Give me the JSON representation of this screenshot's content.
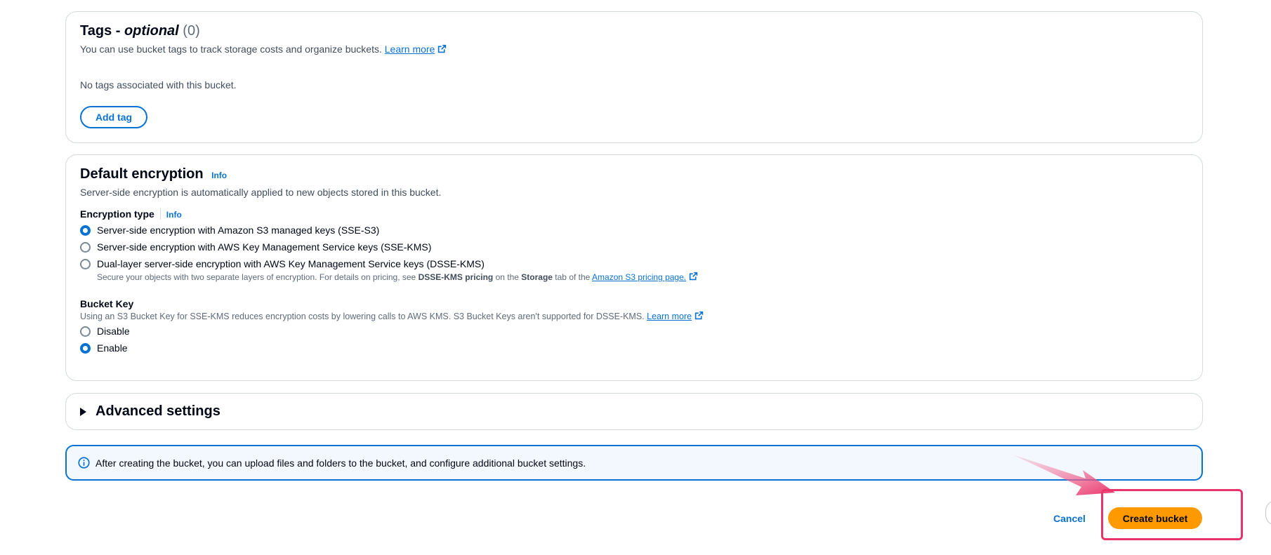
{
  "tags": {
    "title": "Tags - ",
    "title_optional": "optional",
    "count": "(0)",
    "description": "You can use bucket tags to track storage costs and organize buckets.",
    "learn_more": "Learn more",
    "empty_text": "No tags associated with this bucket.",
    "add_tag_label": "Add tag"
  },
  "encryption": {
    "title": "Default encryption",
    "info": "Info",
    "description": "Server-side encryption is automatically applied to new objects stored in this bucket.",
    "type_label": "Encryption type",
    "type_info": "Info",
    "options": [
      {
        "label": "Server-side encryption with Amazon S3 managed keys (SSE-S3)",
        "checked": true
      },
      {
        "label": "Server-side encryption with AWS Key Management Service keys (SSE-KMS)",
        "checked": false
      },
      {
        "label": "Dual-layer server-side encryption with AWS Key Management Service keys (DSSE-KMS)",
        "checked": false
      }
    ],
    "dsse_note_prefix": "Secure your objects with two separate layers of encryption. For details on pricing, see ",
    "dsse_note_bold1": "DSSE-KMS pricing",
    "dsse_note_mid": " on the ",
    "dsse_note_bold2": "Storage",
    "dsse_note_suffix": " tab of the ",
    "dsse_note_link": "Amazon S3 pricing page.",
    "bucket_key": {
      "label": "Bucket Key",
      "description": "Using an S3 Bucket Key for SSE-KMS reduces encryption costs by lowering calls to AWS KMS. S3 Bucket Keys aren't supported for DSSE-KMS.",
      "learn_more": "Learn more",
      "options": [
        {
          "label": "Disable",
          "checked": false
        },
        {
          "label": "Enable",
          "checked": true
        }
      ]
    }
  },
  "advanced": {
    "title": "Advanced settings"
  },
  "alert": {
    "text": "After creating the bucket, you can upload files and folders to the bucket, and configure additional bucket settings."
  },
  "actions": {
    "cancel_label": "Cancel",
    "create_label": "Create bucket"
  },
  "colors": {
    "primary": "#0972d3",
    "cta": "#ff9900",
    "highlight": "#e8336b"
  }
}
